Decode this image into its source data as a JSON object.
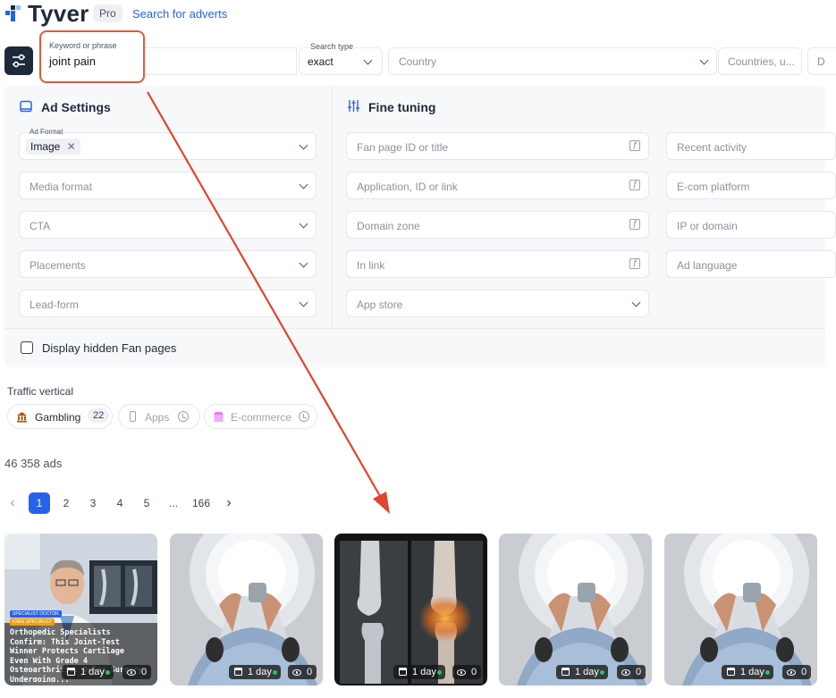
{
  "header": {
    "brand": "Tyver",
    "plan_badge": "Pro",
    "search_link": "Search for adverts"
  },
  "search": {
    "keyword_label": "Keyword or phrase",
    "keyword_value": "joint pain",
    "search_type_label": "Search type",
    "search_type_value": "exact",
    "country_placeholder": "Country",
    "countries_placeholder": "Countries, u...",
    "date_placeholder": "D"
  },
  "ad_settings": {
    "title": "Ad Settings",
    "ad_format_label": "Ad Format",
    "ad_format_chip": "Image",
    "fields": [
      "Media format",
      "CTA",
      "Placements",
      "Lead-form"
    ]
  },
  "fine_tuning": {
    "title": "Fine tuning",
    "col1": [
      "Fan page ID or title",
      "Application, ID or link",
      "Domain zone",
      "In link",
      "App store"
    ],
    "col2": [
      "Recent activity",
      "E-com platform",
      "IP or domain",
      "Ad language"
    ],
    "func_icon_glyph": "f"
  },
  "hidden_fanpages_label": "Display hidden Fan pages",
  "traffic": {
    "label": "Traffic vertical",
    "items": [
      {
        "label": "Gambling",
        "count": "22"
      },
      {
        "label": "Apps"
      },
      {
        "label": "E-commerce"
      }
    ]
  },
  "results": {
    "count_text": "46 358 ads"
  },
  "pagination": {
    "prev": "‹",
    "pages": [
      "1",
      "2",
      "3",
      "4",
      "5",
      "...",
      "166"
    ],
    "next": "›",
    "active": "1"
  },
  "cards": [
    {
      "kind": "doctor",
      "age": "1 day",
      "views": "0",
      "tag1": "SPECIALIST DOCTOR",
      "tag2": "KNEE SPECIALIST",
      "headline": "Orthopedic Specialists Confirm: This Joint-Test Winner Protects Cartilage Even With Grade 4 Osteoarthritis. Delay Surgery Undergoing..."
    },
    {
      "kind": "mri",
      "age": "1 day",
      "views": "0"
    },
    {
      "kind": "xray",
      "age": "1 day",
      "views": "0"
    },
    {
      "kind": "mri",
      "age": "1 day",
      "views": "0"
    },
    {
      "kind": "mri",
      "age": "1 day",
      "views": "0"
    }
  ],
  "colors": {
    "accent": "#2563eb",
    "highlight_box": "#e25a3a",
    "arrow": "#e2452c",
    "dark": "#1e293b"
  }
}
